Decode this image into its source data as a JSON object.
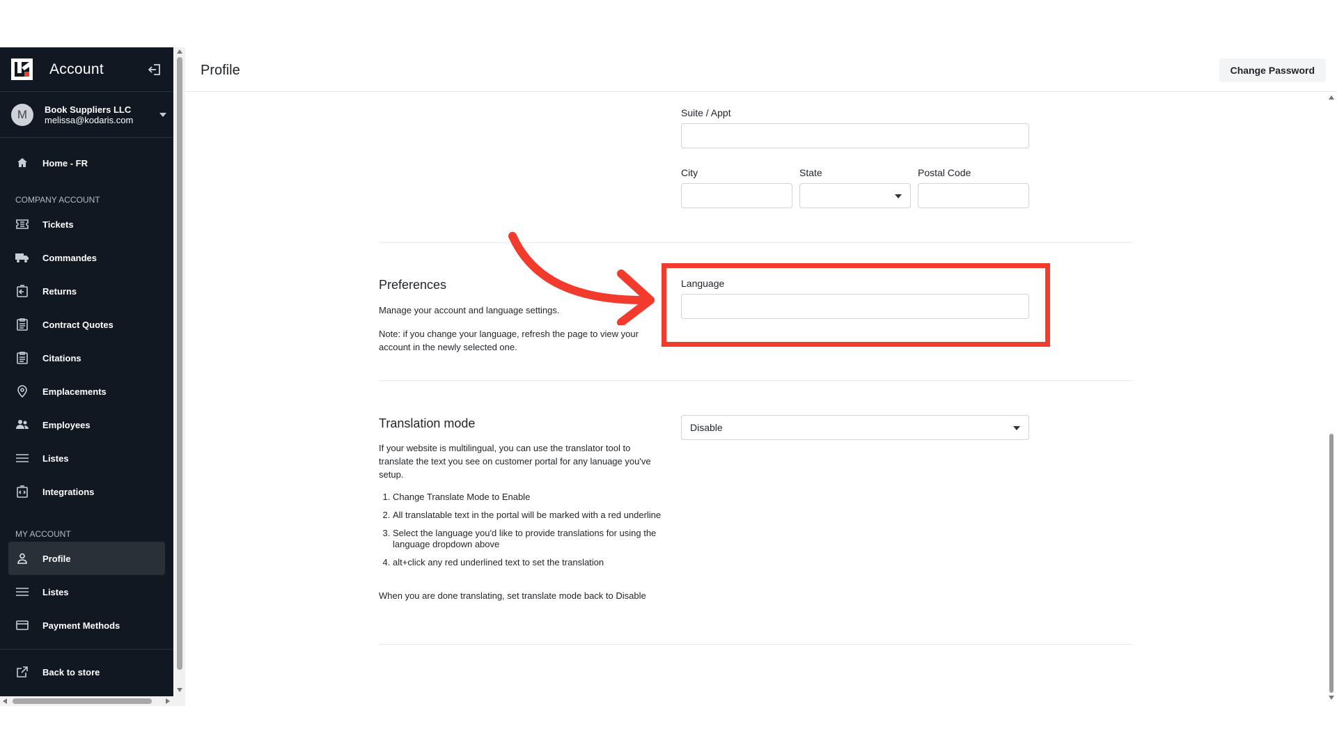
{
  "sidebar": {
    "title": "Account",
    "user": {
      "initial": "M",
      "name": "Book Suppliers LLC",
      "email": "melissa@kodaris.com"
    },
    "home": "Home - FR",
    "section_company": "COMPANY ACCOUNT",
    "company_items": [
      "Tickets",
      "Commandes",
      "Returns",
      "Contract Quotes",
      "Citations",
      "Emplacements",
      "Employees",
      "Listes",
      "Integrations"
    ],
    "section_my": "MY ACCOUNT",
    "my_items": [
      "Profile",
      "Listes",
      "Payment Methods"
    ],
    "back": "Back to store"
  },
  "header": {
    "title": "Profile",
    "change_password": "Change Password"
  },
  "address": {
    "suite_label": "Suite / Appt",
    "city_label": "City",
    "state_label": "State",
    "postal_label": "Postal Code"
  },
  "preferences": {
    "title": "Preferences",
    "desc": "Manage your account and language settings.",
    "note": "Note: if you change your language, refresh the page to view your account in the newly selected one.",
    "language_label": "Language"
  },
  "translation": {
    "title": "Translation mode",
    "desc": "If your website is multilingual, you can use the translator tool to translate the text you see on customer portal for any lanuage you've setup.",
    "steps": [
      "Change Translate Mode to Enable",
      "All translatable text in the portal will be marked with a red underline",
      "Select the language you'd like to provide translations for using the language dropdown above",
      "alt+click any red underlined text to set the translation"
    ],
    "footer": "When you are done translating, set translate mode back to Disable",
    "value": "Disable"
  },
  "colors": {
    "sidebar_bg": "#121821",
    "highlight": "#f23a2d"
  }
}
